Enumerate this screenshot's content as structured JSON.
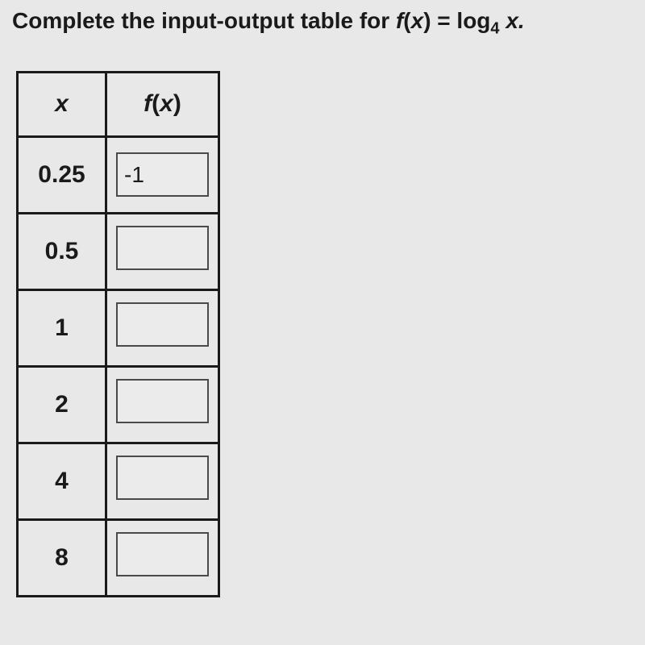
{
  "instruction": {
    "prefix": "Complete the input-output table for ",
    "func": "f",
    "var": "x",
    "eq": " = log",
    "base": "4",
    "suffix": " x."
  },
  "chart_data": {
    "type": "table",
    "title": "Input-output table for f(x) = log_4 x",
    "columns": [
      "x",
      "f(x)"
    ],
    "rows": [
      {
        "x": "0.25",
        "fx": "-1"
      },
      {
        "x": "0.5",
        "fx": ""
      },
      {
        "x": "1",
        "fx": ""
      },
      {
        "x": "2",
        "fx": ""
      },
      {
        "x": "4",
        "fx": ""
      },
      {
        "x": "8",
        "fx": ""
      }
    ]
  },
  "headers": {
    "x": "x",
    "fx_f": "f",
    "fx_open": "(",
    "fx_x": "x",
    "fx_close": ")"
  }
}
